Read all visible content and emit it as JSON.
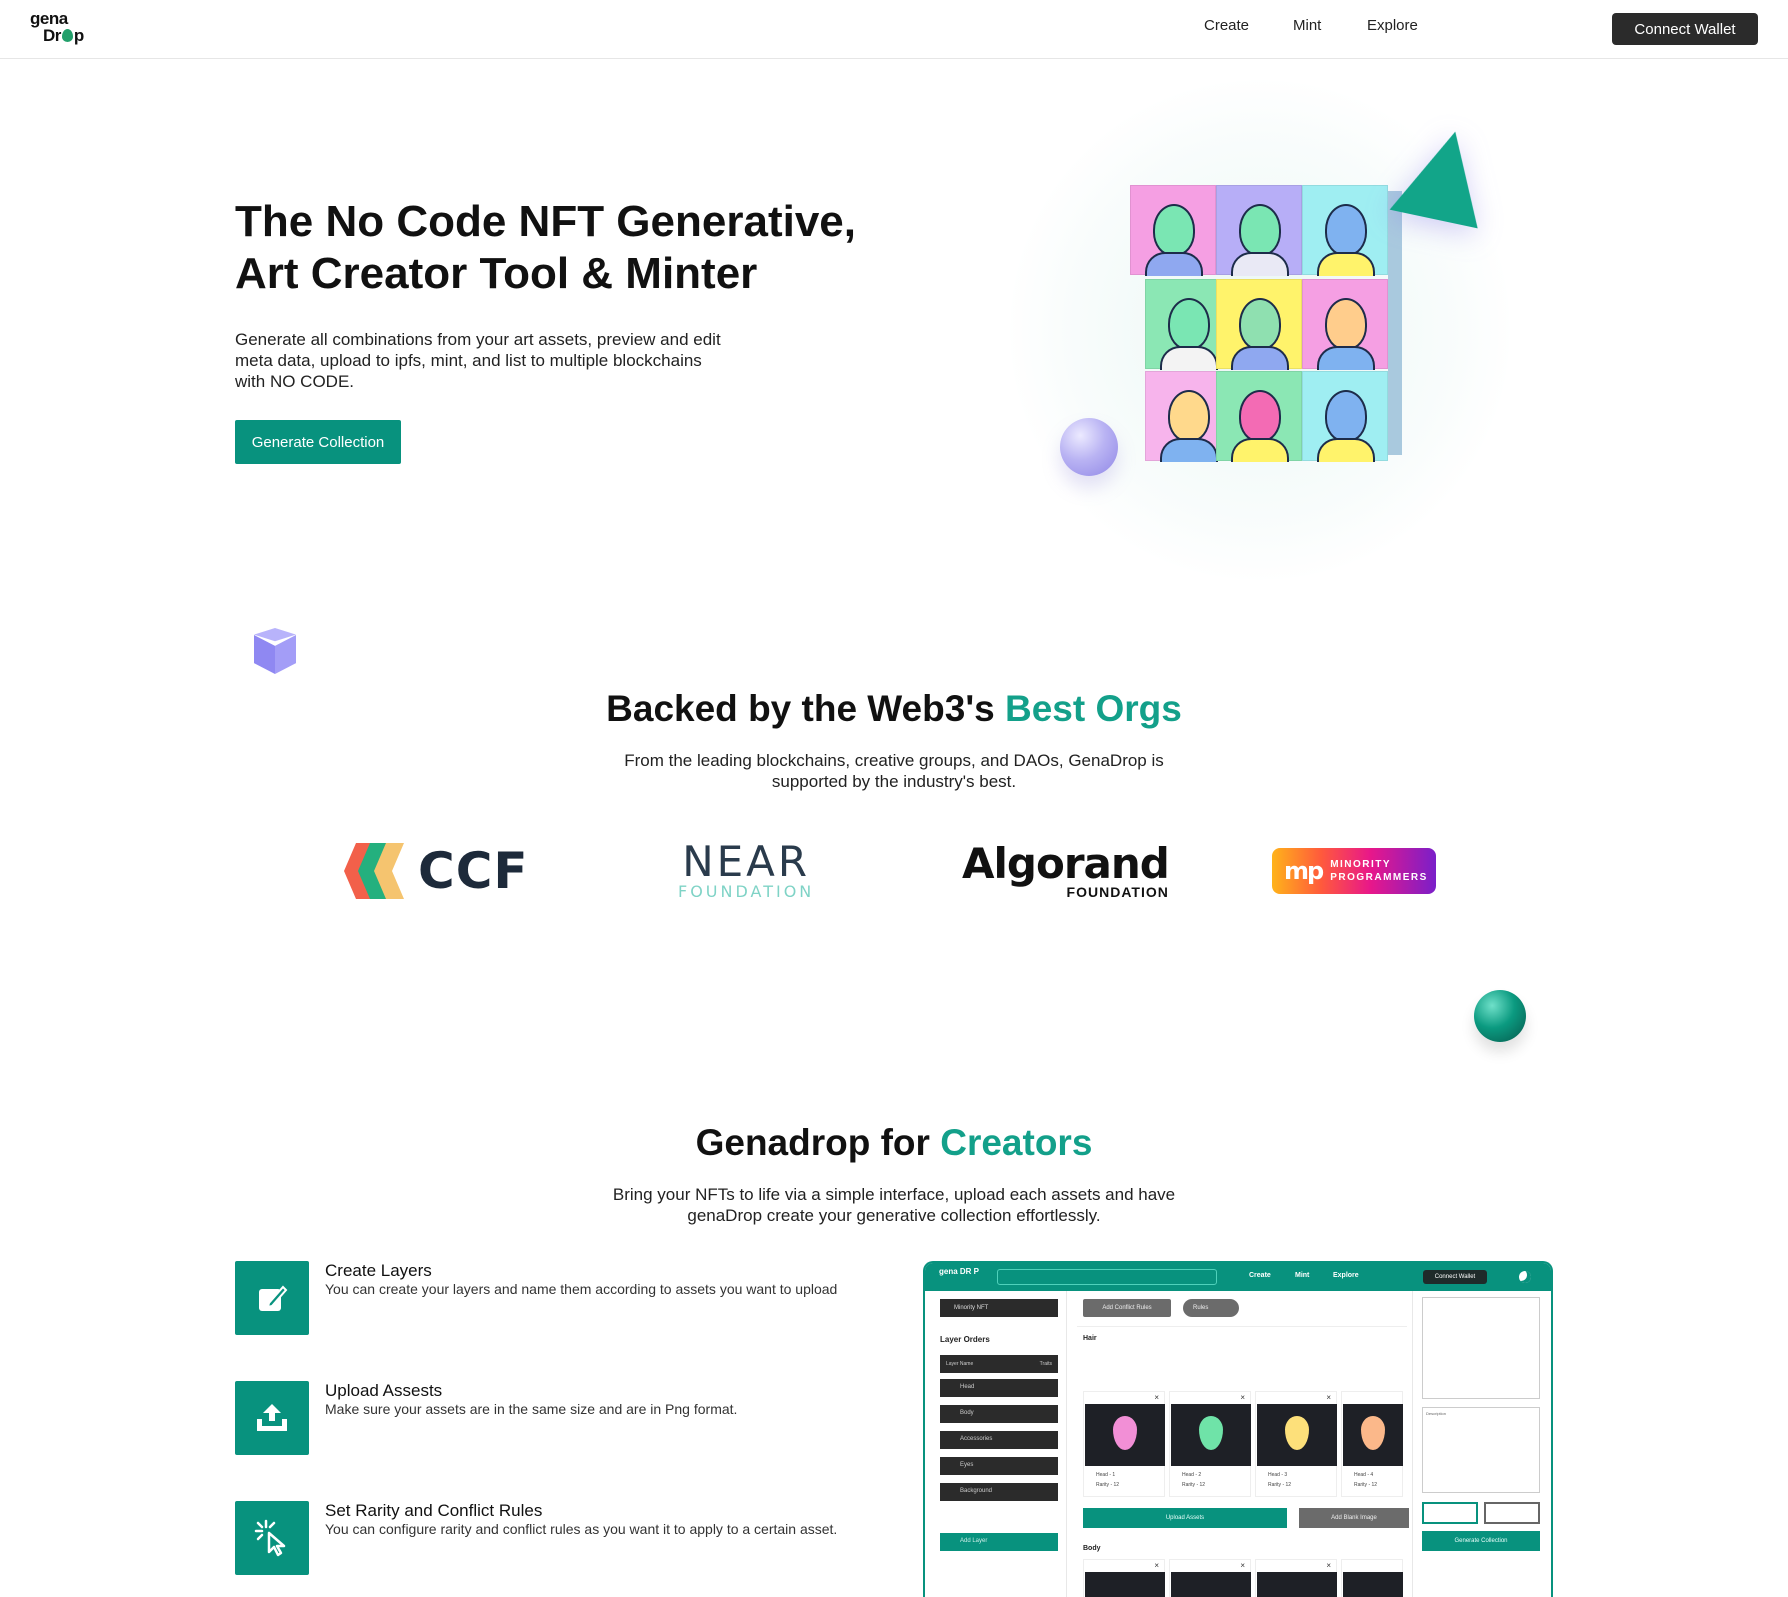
{
  "nav": {
    "logo_line1": "gena",
    "logo_line2_a": "Dr",
    "logo_line2_b": "p",
    "links": [
      "Create",
      "Mint",
      "Explore"
    ],
    "connect_label": "Connect Wallet"
  },
  "hero": {
    "title_line1": "The No Code NFT Generative,",
    "title_line2": "Art Creator Tool & Minter",
    "description": "Generate all combinations from your art assets, preview and edit meta data, upload to ipfs, mint, and list to multiple blockchains with NO CODE.",
    "cta_label": "Generate Collection"
  },
  "backed": {
    "title_plain": "Backed by the Web3's ",
    "title_accent": "Best Orgs",
    "subtitle": "From the leading blockchains, creative groups, and DAOs, GenaDrop is supported by the industry's best.",
    "partners": {
      "ccf": "CCF",
      "near": "NEAR",
      "near_sub": "FOUNDATION",
      "algorand": "Algorand",
      "algorand_sub": "FOUNDATION",
      "mp_icon": "mp",
      "mp_line1": "MINORITY",
      "mp_line2": "PROGRAMMERS"
    }
  },
  "creators": {
    "title_plain": "Genadrop for ",
    "title_accent": "Creators",
    "subtitle": "Bring your NFTs to life via a simple interface, upload each assets and have genaDrop create your generative collection effortlessly.",
    "features": [
      {
        "title": "Create Layers",
        "desc": "You can create your layers and name them according to assets you want to upload",
        "icon": "edit-icon"
      },
      {
        "title": "Upload Assests",
        "desc": "Make sure your assets are in the same size and are in Png format.",
        "icon": "upload-icon"
      },
      {
        "title": "Set Rarity and Conflict Rules",
        "desc": "You can configure rarity and conflict rules as you want it to apply to a certain asset.",
        "icon": "cursor-click-icon"
      }
    ]
  },
  "preview": {
    "logo": "gena DR P",
    "links": [
      "Create",
      "Mint",
      "Explore"
    ],
    "connect": "Connect Wallet",
    "collection_name": "Minority NFT",
    "layer_orders": "Layer Orders",
    "th_name": "Layer Name",
    "th_traits": "Traits",
    "layers": [
      "Head",
      "Body",
      "Accessories",
      "Eyes",
      "Background"
    ],
    "add_layer": "Add Layer",
    "add_conflict": "Add Conflict Rules",
    "rules": "Rules",
    "cat_hair": "Hair",
    "cat_body": "Body",
    "cards": [
      {
        "name": "Head - 1",
        "rarity": "Rarity - 12"
      },
      {
        "name": "Head - 2",
        "rarity": "Rarity - 12"
      },
      {
        "name": "Head - 3",
        "rarity": "Rarity - 12"
      },
      {
        "name": "Head - 4",
        "rarity": "Rarity - 12"
      }
    ],
    "upload_assets": "Upload Assets",
    "add_blank": "Add Blank Image",
    "description_label": "Description",
    "gen_collection": "Generate Collection"
  },
  "colors": {
    "accent": "#08927e",
    "accent_text": "#13a08a",
    "dark_button": "#2b2b2b"
  }
}
